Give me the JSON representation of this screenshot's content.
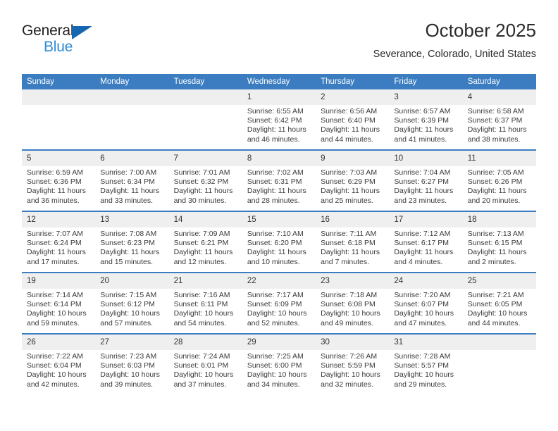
{
  "brand": {
    "name_part1": "General",
    "name_part2": "Blue",
    "accent_color": "#2e8bd4",
    "triangle_color": "#1567b2"
  },
  "header": {
    "title": "October 2025",
    "subtitle": "Severance, Colorado, United States"
  },
  "theme": {
    "header_bg": "#3b7dc0",
    "daynum_bg": "#efefef",
    "text_color": "#333333"
  },
  "weekdays": [
    "Sunday",
    "Monday",
    "Tuesday",
    "Wednesday",
    "Thursday",
    "Friday",
    "Saturday"
  ],
  "labels": {
    "sunrise": "Sunrise:",
    "sunset": "Sunset:",
    "daylight": "Daylight:"
  },
  "weeks": [
    [
      {
        "day": "",
        "empty": true
      },
      {
        "day": "",
        "empty": true
      },
      {
        "day": "",
        "empty": true
      },
      {
        "day": "1",
        "sunrise": "Sunrise: 6:55 AM",
        "sunset": "Sunset: 6:42 PM",
        "daylight1": "Daylight: 11 hours",
        "daylight2": "and 46 minutes."
      },
      {
        "day": "2",
        "sunrise": "Sunrise: 6:56 AM",
        "sunset": "Sunset: 6:40 PM",
        "daylight1": "Daylight: 11 hours",
        "daylight2": "and 44 minutes."
      },
      {
        "day": "3",
        "sunrise": "Sunrise: 6:57 AM",
        "sunset": "Sunset: 6:39 PM",
        "daylight1": "Daylight: 11 hours",
        "daylight2": "and 41 minutes."
      },
      {
        "day": "4",
        "sunrise": "Sunrise: 6:58 AM",
        "sunset": "Sunset: 6:37 PM",
        "daylight1": "Daylight: 11 hours",
        "daylight2": "and 38 minutes."
      }
    ],
    [
      {
        "day": "5",
        "sunrise": "Sunrise: 6:59 AM",
        "sunset": "Sunset: 6:36 PM",
        "daylight1": "Daylight: 11 hours",
        "daylight2": "and 36 minutes."
      },
      {
        "day": "6",
        "sunrise": "Sunrise: 7:00 AM",
        "sunset": "Sunset: 6:34 PM",
        "daylight1": "Daylight: 11 hours",
        "daylight2": "and 33 minutes."
      },
      {
        "day": "7",
        "sunrise": "Sunrise: 7:01 AM",
        "sunset": "Sunset: 6:32 PM",
        "daylight1": "Daylight: 11 hours",
        "daylight2": "and 30 minutes."
      },
      {
        "day": "8",
        "sunrise": "Sunrise: 7:02 AM",
        "sunset": "Sunset: 6:31 PM",
        "daylight1": "Daylight: 11 hours",
        "daylight2": "and 28 minutes."
      },
      {
        "day": "9",
        "sunrise": "Sunrise: 7:03 AM",
        "sunset": "Sunset: 6:29 PM",
        "daylight1": "Daylight: 11 hours",
        "daylight2": "and 25 minutes."
      },
      {
        "day": "10",
        "sunrise": "Sunrise: 7:04 AM",
        "sunset": "Sunset: 6:27 PM",
        "daylight1": "Daylight: 11 hours",
        "daylight2": "and 23 minutes."
      },
      {
        "day": "11",
        "sunrise": "Sunrise: 7:05 AM",
        "sunset": "Sunset: 6:26 PM",
        "daylight1": "Daylight: 11 hours",
        "daylight2": "and 20 minutes."
      }
    ],
    [
      {
        "day": "12",
        "sunrise": "Sunrise: 7:07 AM",
        "sunset": "Sunset: 6:24 PM",
        "daylight1": "Daylight: 11 hours",
        "daylight2": "and 17 minutes."
      },
      {
        "day": "13",
        "sunrise": "Sunrise: 7:08 AM",
        "sunset": "Sunset: 6:23 PM",
        "daylight1": "Daylight: 11 hours",
        "daylight2": "and 15 minutes."
      },
      {
        "day": "14",
        "sunrise": "Sunrise: 7:09 AM",
        "sunset": "Sunset: 6:21 PM",
        "daylight1": "Daylight: 11 hours",
        "daylight2": "and 12 minutes."
      },
      {
        "day": "15",
        "sunrise": "Sunrise: 7:10 AM",
        "sunset": "Sunset: 6:20 PM",
        "daylight1": "Daylight: 11 hours",
        "daylight2": "and 10 minutes."
      },
      {
        "day": "16",
        "sunrise": "Sunrise: 7:11 AM",
        "sunset": "Sunset: 6:18 PM",
        "daylight1": "Daylight: 11 hours",
        "daylight2": "and 7 minutes."
      },
      {
        "day": "17",
        "sunrise": "Sunrise: 7:12 AM",
        "sunset": "Sunset: 6:17 PM",
        "daylight1": "Daylight: 11 hours",
        "daylight2": "and 4 minutes."
      },
      {
        "day": "18",
        "sunrise": "Sunrise: 7:13 AM",
        "sunset": "Sunset: 6:15 PM",
        "daylight1": "Daylight: 11 hours",
        "daylight2": "and 2 minutes."
      }
    ],
    [
      {
        "day": "19",
        "sunrise": "Sunrise: 7:14 AM",
        "sunset": "Sunset: 6:14 PM",
        "daylight1": "Daylight: 10 hours",
        "daylight2": "and 59 minutes."
      },
      {
        "day": "20",
        "sunrise": "Sunrise: 7:15 AM",
        "sunset": "Sunset: 6:12 PM",
        "daylight1": "Daylight: 10 hours",
        "daylight2": "and 57 minutes."
      },
      {
        "day": "21",
        "sunrise": "Sunrise: 7:16 AM",
        "sunset": "Sunset: 6:11 PM",
        "daylight1": "Daylight: 10 hours",
        "daylight2": "and 54 minutes."
      },
      {
        "day": "22",
        "sunrise": "Sunrise: 7:17 AM",
        "sunset": "Sunset: 6:09 PM",
        "daylight1": "Daylight: 10 hours",
        "daylight2": "and 52 minutes."
      },
      {
        "day": "23",
        "sunrise": "Sunrise: 7:18 AM",
        "sunset": "Sunset: 6:08 PM",
        "daylight1": "Daylight: 10 hours",
        "daylight2": "and 49 minutes."
      },
      {
        "day": "24",
        "sunrise": "Sunrise: 7:20 AM",
        "sunset": "Sunset: 6:07 PM",
        "daylight1": "Daylight: 10 hours",
        "daylight2": "and 47 minutes."
      },
      {
        "day": "25",
        "sunrise": "Sunrise: 7:21 AM",
        "sunset": "Sunset: 6:05 PM",
        "daylight1": "Daylight: 10 hours",
        "daylight2": "and 44 minutes."
      }
    ],
    [
      {
        "day": "26",
        "sunrise": "Sunrise: 7:22 AM",
        "sunset": "Sunset: 6:04 PM",
        "daylight1": "Daylight: 10 hours",
        "daylight2": "and 42 minutes."
      },
      {
        "day": "27",
        "sunrise": "Sunrise: 7:23 AM",
        "sunset": "Sunset: 6:03 PM",
        "daylight1": "Daylight: 10 hours",
        "daylight2": "and 39 minutes."
      },
      {
        "day": "28",
        "sunrise": "Sunrise: 7:24 AM",
        "sunset": "Sunset: 6:01 PM",
        "daylight1": "Daylight: 10 hours",
        "daylight2": "and 37 minutes."
      },
      {
        "day": "29",
        "sunrise": "Sunrise: 7:25 AM",
        "sunset": "Sunset: 6:00 PM",
        "daylight1": "Daylight: 10 hours",
        "daylight2": "and 34 minutes."
      },
      {
        "day": "30",
        "sunrise": "Sunrise: 7:26 AM",
        "sunset": "Sunset: 5:59 PM",
        "daylight1": "Daylight: 10 hours",
        "daylight2": "and 32 minutes."
      },
      {
        "day": "31",
        "sunrise": "Sunrise: 7:28 AM",
        "sunset": "Sunset: 5:57 PM",
        "daylight1": "Daylight: 10 hours",
        "daylight2": "and 29 minutes."
      },
      {
        "day": "",
        "empty": true
      }
    ]
  ]
}
